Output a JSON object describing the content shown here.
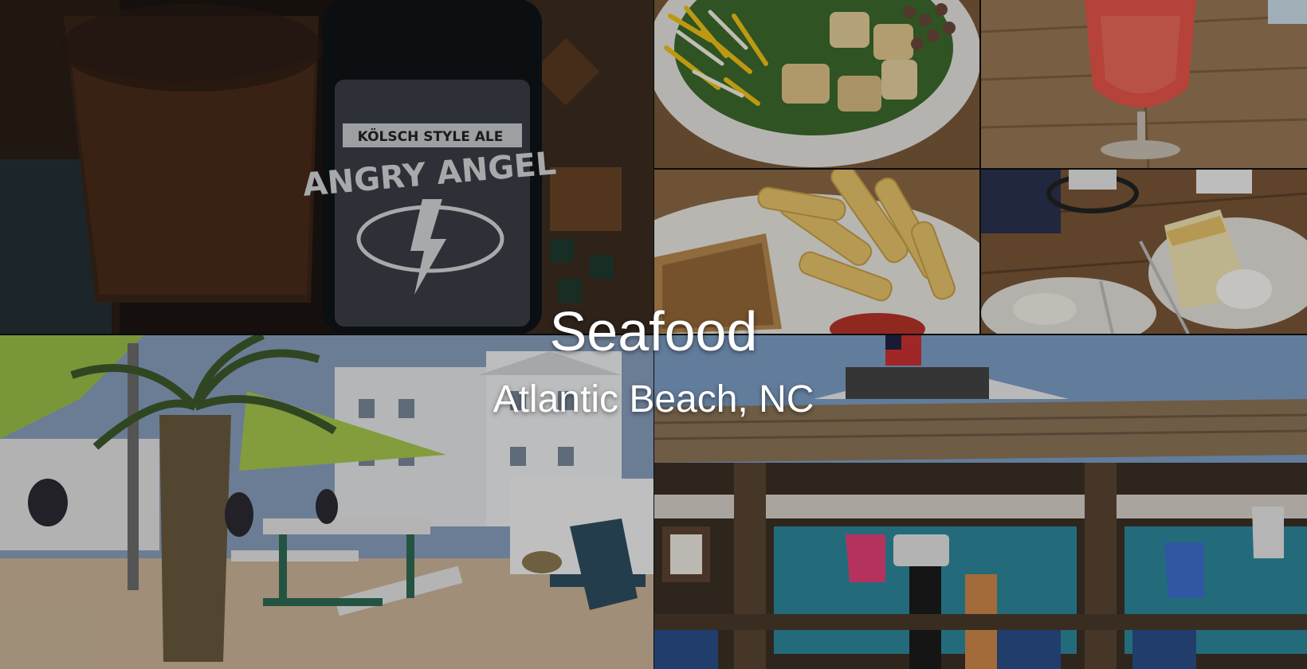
{
  "hero": {
    "title": "Seafood",
    "subtitle": "Atlantic Beach, NC"
  },
  "photos": {
    "beer_label_top": "KÖLSCH STYLE ALE",
    "beer_label_main": "ANGRY ANGEL"
  },
  "colors": {
    "title_text": "#ffffff",
    "overlay": "rgba(0,0,0,0.22)",
    "photo_divider": "#cfcfcf"
  }
}
